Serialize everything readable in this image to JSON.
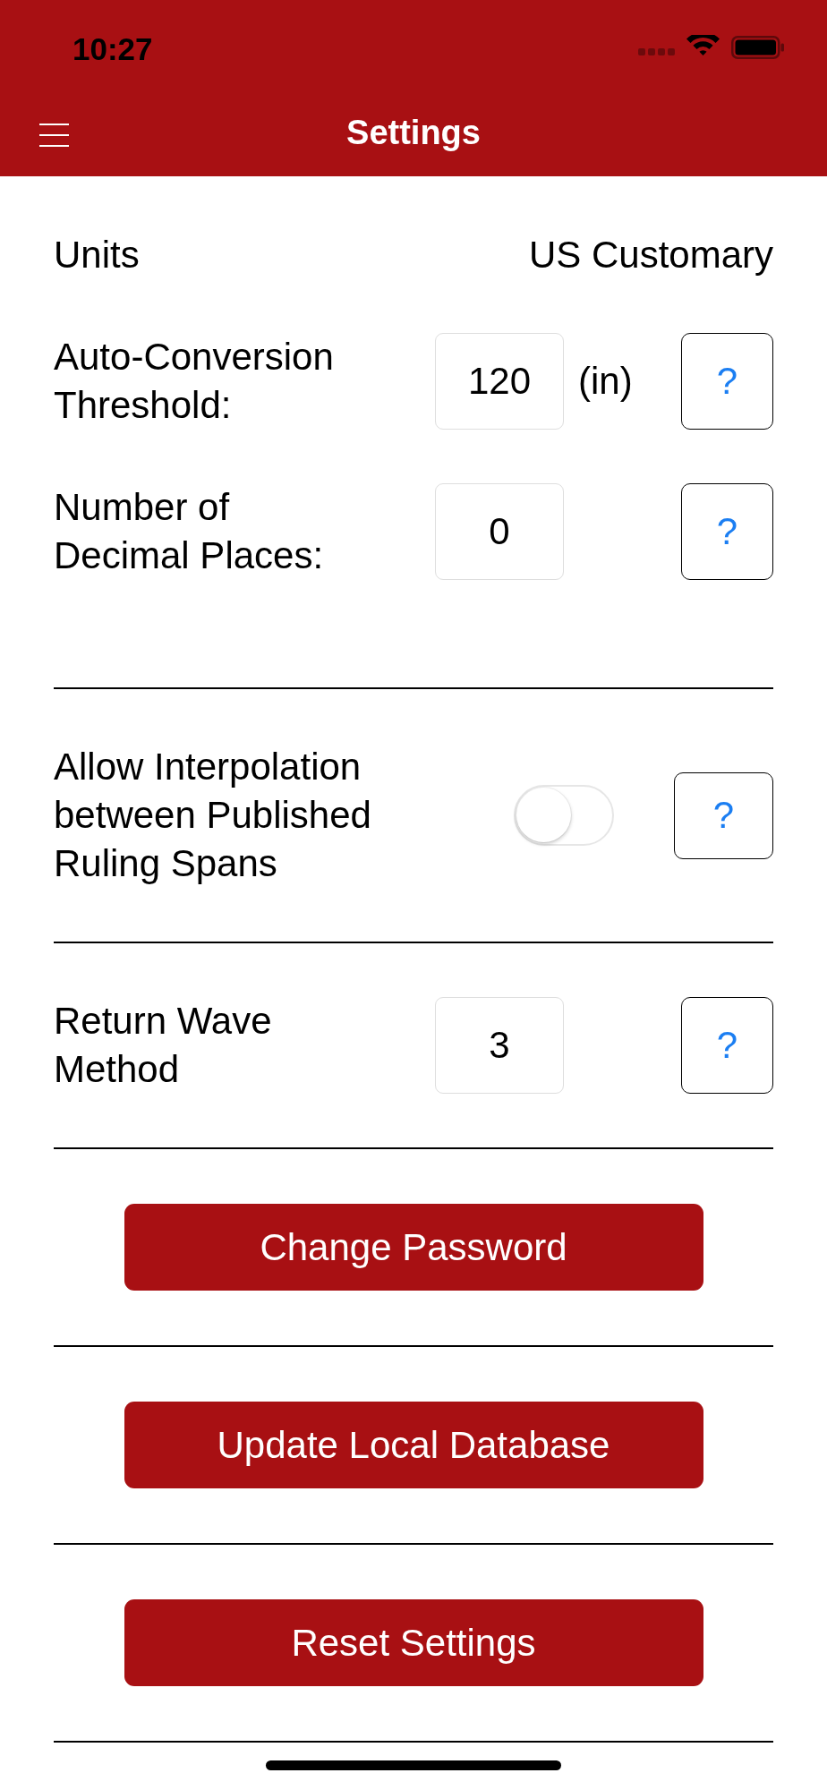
{
  "status_bar": {
    "time": "10:27"
  },
  "nav_bar": {
    "title": "Settings"
  },
  "sections": [
    {
      "rows": [
        {
          "kind": "value",
          "label": "Units",
          "value": "US Customary"
        },
        {
          "kind": "number",
          "label": "Auto-Conversion Threshold:",
          "value": "120",
          "unit": "(in)",
          "help": "?"
        },
        {
          "kind": "number",
          "label": "Number of Decimal Places:",
          "value": "0",
          "help": "?"
        }
      ]
    },
    {
      "rows": [
        {
          "kind": "toggle",
          "label": "Allow Interpolation between Published Ruling Spans",
          "on": false,
          "help": "?"
        }
      ]
    },
    {
      "rows": [
        {
          "kind": "number",
          "label": "Return Wave Method",
          "value": "3",
          "help": "?"
        }
      ]
    }
  ],
  "buttons": [
    {
      "label": "Change Password"
    },
    {
      "label": "Update Local Database"
    },
    {
      "label": "Reset Settings"
    }
  ]
}
